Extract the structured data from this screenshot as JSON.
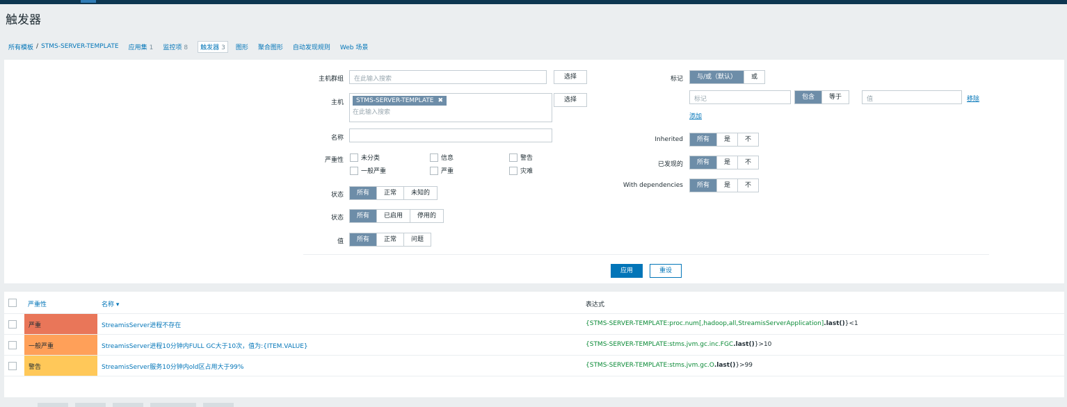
{
  "page_title": "触发器",
  "breadcrumb": {
    "all_templates": "所有模板",
    "separator": "/",
    "template": "STMS-SERVER-TEMPLATE"
  },
  "tabs": [
    {
      "label": "应用集",
      "count": "1"
    },
    {
      "label": "监控项",
      "count": "8"
    },
    {
      "label": "触发器",
      "count": "3"
    },
    {
      "label": "图形",
      "count": ""
    },
    {
      "label": "聚合图形",
      "count": ""
    },
    {
      "label": "自动发现规则",
      "count": ""
    },
    {
      "label": "Web 场景",
      "count": ""
    }
  ],
  "filter": {
    "host_group_label": "主机群组",
    "host_group_placeholder": "在此输入搜索",
    "select_label": "选择",
    "host_label": "主机",
    "host_tag": "STMS-SERVER-TEMPLATE",
    "host_tag_remove": "✖",
    "host_placeholder": "在此输入搜索",
    "name_label": "名称",
    "name_value": "",
    "severity_label": "严重性",
    "severities": [
      "未分类",
      "信息",
      "警告",
      "一般严重",
      "严重",
      "灾难"
    ],
    "state_label": "状态",
    "state_options": [
      "所有",
      "正常",
      "未知的"
    ],
    "status_label": "状态",
    "status_options": [
      "所有",
      "已启用",
      "停用的"
    ],
    "value_label": "值",
    "value_options": [
      "所有",
      "正常",
      "问题"
    ],
    "tags_label": "标记",
    "tags_mode": [
      "与/或（默认）",
      "或"
    ],
    "tag_name_placeholder": "标记",
    "tag_op": [
      "包含",
      "等于"
    ],
    "tag_value_placeholder": "值",
    "remove_label": "移除",
    "add_label": "添加",
    "inherited_label": "Inherited",
    "inherited_options": [
      "所有",
      "是",
      "不"
    ],
    "discovered_label": "已发现的",
    "discovered_options": [
      "所有",
      "是",
      "不"
    ],
    "deps_label": "With dependencies",
    "deps_options": [
      "所有",
      "是",
      "不"
    ],
    "apply_label": "应用",
    "reset_label": "重设"
  },
  "table": {
    "headers": {
      "severity": "严重性",
      "name": "名称 ▾",
      "expression": "表达式"
    },
    "rows": [
      {
        "severity": "严重",
        "color": "#e97659",
        "name": "StreamisServer进程不存在",
        "expr_host": "{STMS-SERVER-TEMPLATE:proc.num[,hadoop,all,StreamisServerApplication]",
        "expr_fn": ".last()",
        "expr_tail": "}<1"
      },
      {
        "severity": "一般严重",
        "color": "#ffa059",
        "name": "StreamisServer进程10分钟内FULL GC大于10次，值为:{ITEM.VALUE}",
        "expr_host": "{STMS-SERVER-TEMPLATE:stms.jvm.gc.inc.FGC",
        "expr_fn": ".last()",
        "expr_tail": "}>10"
      },
      {
        "severity": "警告",
        "color": "#ffc859",
        "name": "StreamisServer服务10分钟内old区占用大于99%",
        "expr_host": "{STMS-SERVER-TEMPLATE:stms.jvm.gc.O",
        "expr_fn": ".last()",
        "expr_tail": "}>99"
      }
    ]
  }
}
